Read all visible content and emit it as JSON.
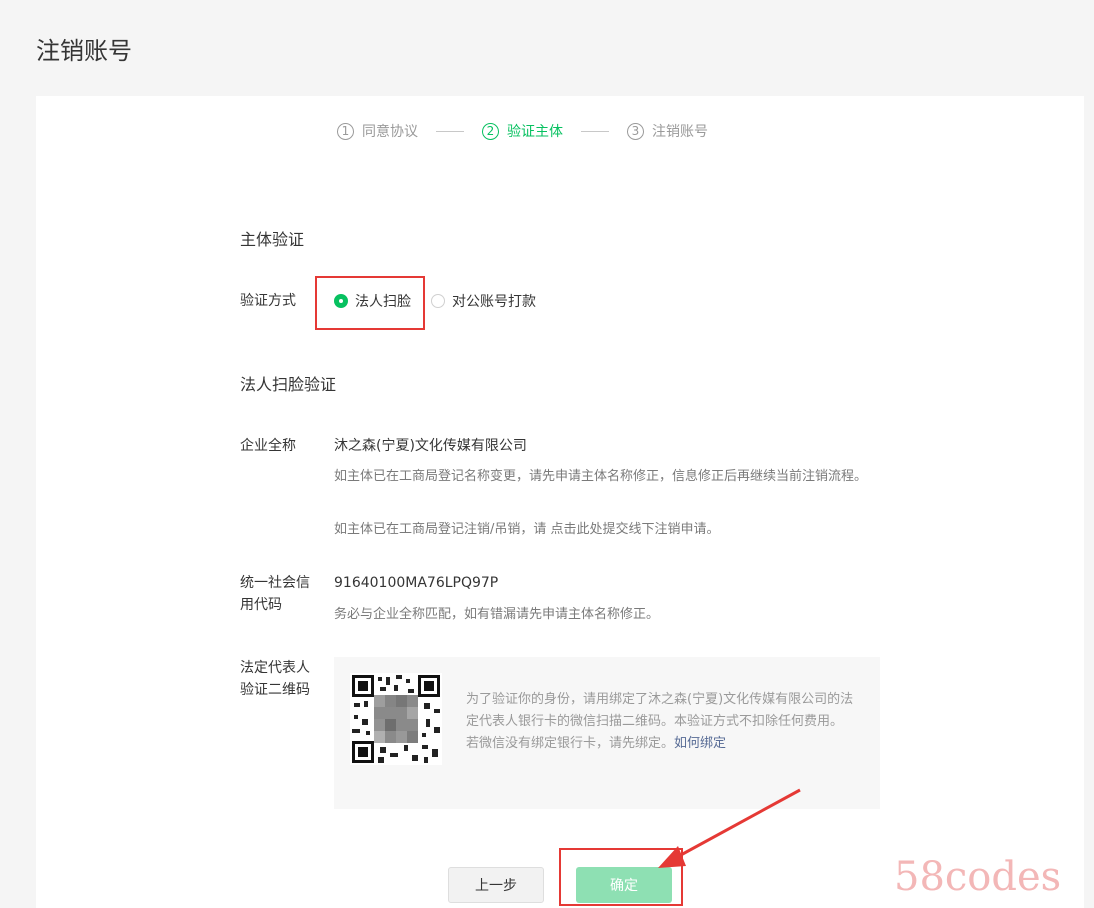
{
  "page": {
    "title": "注销账号"
  },
  "steps": [
    {
      "num": "1",
      "label": "同意协议",
      "active": false
    },
    {
      "num": "2",
      "label": "验证主体",
      "active": true
    },
    {
      "num": "3",
      "label": "注销账号",
      "active": false
    }
  ],
  "verify": {
    "section_title": "主体验证",
    "method_label": "验证方式",
    "options": [
      {
        "label": "法人扫脸",
        "checked": true
      },
      {
        "label": "对公账号打款",
        "checked": false
      }
    ]
  },
  "face": {
    "section_title": "法人扫脸验证",
    "company_label": "企业全称",
    "company_name": "沐之森(宁夏)文化传媒有限公司",
    "company_hint_1": "如主体已在工商局登记名称变更，请先申请主体名称修正，信息修正后再继续当前注销流程。",
    "company_hint_2": "如主体已在工商局登记注销/吊销，请 点击此处提交线下注销申请。",
    "credit_label": "统一社会信用代码",
    "credit_code": "91640100MA76LPQ97P",
    "credit_hint": "务必与企业全称匹配，如有错漏请先申请主体名称修正。",
    "qr_label": "法定代表人验证二维码",
    "qr_text_1": "为了验证你的身份，请用绑定了沐之森(宁夏)文化传媒有限公司的法定代表人银行卡的微信扫描二维码。本验证方式不扣除任何费用。",
    "qr_text_2": "若微信没有绑定银行卡，请先绑定。",
    "qr_link": "如何绑定"
  },
  "buttons": {
    "prev": "上一步",
    "confirm": "确定"
  },
  "watermark": "58codes",
  "colors": {
    "accent": "#07c160",
    "highlight": "#e53935",
    "link": "#576b95"
  }
}
